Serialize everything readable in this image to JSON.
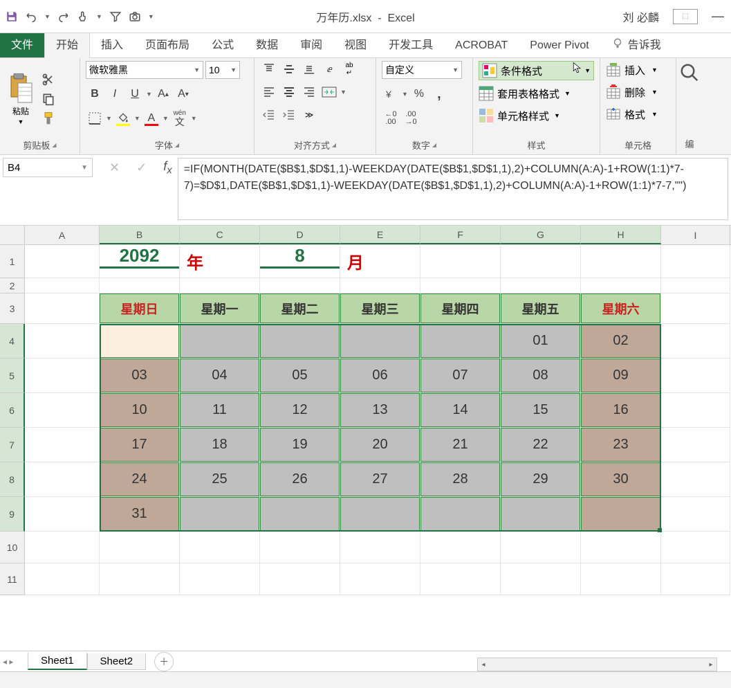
{
  "title": {
    "filename": "万年历.xlsx",
    "app": "Excel",
    "user": "刘 必麟"
  },
  "qat": {
    "save": "保存",
    "undo": "撤销",
    "redo": "重做",
    "touch": "触摸",
    "filter": "筛选",
    "camera": "相机"
  },
  "tabs": {
    "file": "文件",
    "home": "开始",
    "insert": "插入",
    "layout": "页面布局",
    "formulas": "公式",
    "data": "数据",
    "review": "审阅",
    "view": "视图",
    "dev": "开发工具",
    "acrobat": "ACROBAT",
    "pivot": "Power Pivot",
    "tell": "告诉我"
  },
  "ribbon": {
    "clipboard": {
      "label": "剪贴板",
      "paste": "粘贴"
    },
    "font": {
      "label": "字体",
      "name": "微软雅黑",
      "size": "10",
      "bold": "B",
      "italic": "I",
      "underline": "U",
      "wen": "wén",
      "wenchar": "文"
    },
    "align": {
      "label": "对齐方式",
      "wrap": "ab"
    },
    "number": {
      "label": "数字",
      "format": "自定义",
      "percent": "%",
      "comma": ","
    },
    "styles": {
      "label": "样式",
      "cond": "条件格式",
      "table": "套用表格格式",
      "cell": "单元格样式"
    },
    "cells": {
      "label": "单元格",
      "insert": "插入",
      "delete": "删除",
      "format": "格式"
    },
    "edit": {
      "label": "编"
    }
  },
  "fbar": {
    "ref": "B4",
    "formula": "=IF(MONTH(DATE($B$1,$D$1,1)-WEEKDAY(DATE($B$1,$D$1,1),2)+COLUMN(A:A)-1+ROW(1:1)*7-7)=$D$1,DATE($B$1,$D$1,1)-WEEKDAY(DATE($B$1,$D$1,1),2)+COLUMN(A:A)-1+ROW(1:1)*7-7,\"\")"
  },
  "columns": [
    "A",
    "B",
    "C",
    "D",
    "E",
    "F",
    "G",
    "H",
    "I"
  ],
  "rows": [
    "1",
    "2",
    "3",
    "4",
    "5",
    "6",
    "7",
    "8",
    "9",
    "10",
    "11"
  ],
  "calendar": {
    "year": "2092",
    "year_lbl": "年",
    "month": "8",
    "month_lbl": "月",
    "weekdays": [
      "星期日",
      "星期一",
      "星期二",
      "星期三",
      "星期四",
      "星期五",
      "星期六"
    ],
    "days": [
      [
        "",
        "",
        "",
        "",
        "",
        "01",
        "02"
      ],
      [
        "03",
        "04",
        "05",
        "06",
        "07",
        "08",
        "09"
      ],
      [
        "10",
        "11",
        "12",
        "13",
        "14",
        "15",
        "16"
      ],
      [
        "17",
        "18",
        "19",
        "20",
        "21",
        "22",
        "23"
      ],
      [
        "24",
        "25",
        "26",
        "27",
        "28",
        "29",
        "30"
      ],
      [
        "31",
        "",
        "",
        "",
        "",
        "",
        ""
      ]
    ]
  },
  "sheets": {
    "s1": "Sheet1",
    "s2": "Sheet2"
  }
}
